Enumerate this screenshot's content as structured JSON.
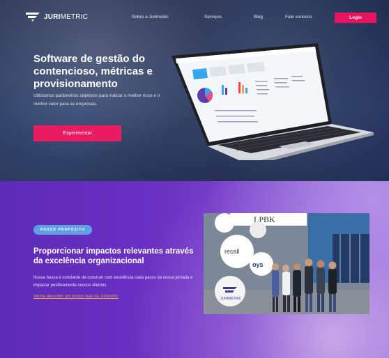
{
  "brand": {
    "name_bold": "JURI",
    "name_regular": "METRIC"
  },
  "nav": {
    "links": [
      "Sobre a Jurimetric",
      "Serviços",
      "Blog",
      "Fale conosco"
    ],
    "login_label": "Login"
  },
  "hero": {
    "title": "Software de gestão do contencioso, métricas e provisionamento",
    "subtitle": "Utilizamos parâmetros objetivos para indicar o melhor risco e o melhor valor para as empresas.",
    "cta_label": "Experimentar"
  },
  "purpose": {
    "badge": "NOSSO PROPÓSITO",
    "title": "Proporcionar impactos relevantes através da excelência organizacional",
    "body": "Nossa busca é constante de construir com excelência cada passo da nossa jornada e impactar positivamente nossos clientes.",
    "link": "Venha descobrir um pouco mais da Jurimetric"
  },
  "photo": {
    "banner_lpbk": "LPBK",
    "banner_recall": "recall",
    "banner_oys": "oys",
    "logo_text": "JURIMETRIC"
  },
  "colors": {
    "accent": "#e8145e",
    "purple": "#6a31c2",
    "badge": "#5fa0e6",
    "link": "#f2a24a"
  }
}
